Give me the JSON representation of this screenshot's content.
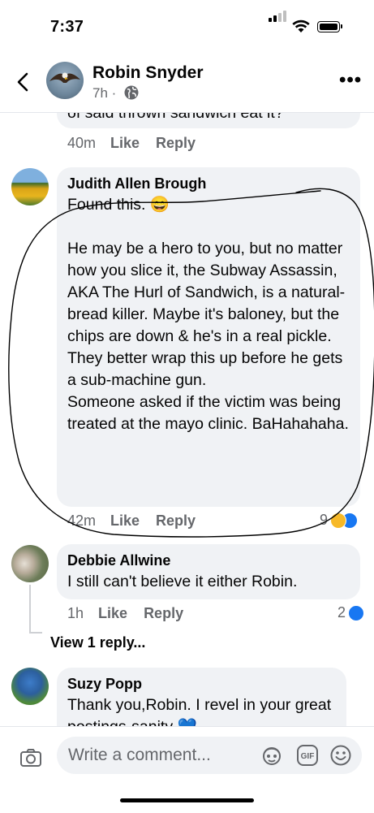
{
  "status_bar": {
    "time": "7:37"
  },
  "header": {
    "name": "Robin Snyder",
    "subtitle": "7h ·"
  },
  "comments": [
    {
      "text_partial": "of said thrown sandwich eat it?",
      "time": "40m",
      "like": "Like",
      "reply": "Reply"
    },
    {
      "author": "Judith Allen Brough",
      "text": "Found this. 😄\n\nHe may be a hero to you, but no matter how you slice it, the Subway Assassin, AKA The Hurl of Sandwich, is a natural-bread killer. Maybe it's baloney, but the chips are down & he's in a real pickle. They better wrap this up before he gets a sub-machine gun.\nSomeone asked if the victim was being treated at the mayo clinic. BaHahahaha.",
      "time": "42m",
      "like": "Like",
      "reply": "Reply",
      "reaction_count": "9"
    },
    {
      "author": "Debbie Allwine",
      "text": "I still can't believe it either Robin.",
      "time": "1h",
      "like": "Like",
      "reply": "Reply",
      "reaction_count": "2",
      "view_replies": "View 1 reply..."
    },
    {
      "author": "Suzy Popp",
      "text": "Thank you,Robin. I revel in your great postings-sanity 💙"
    }
  ],
  "composer": {
    "placeholder": "Write a comment..."
  },
  "colors": {
    "like_blue": "#1877f2",
    "haha_yellow": "#f7b928",
    "ink_annotation": "#000000"
  }
}
